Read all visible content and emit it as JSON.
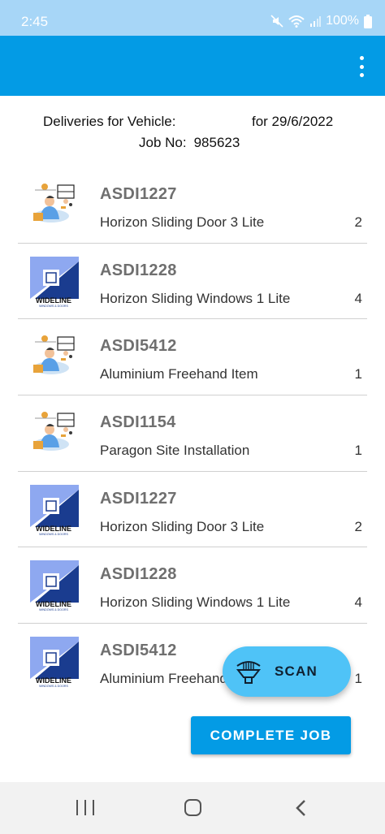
{
  "status_bar": {
    "time": "2:45",
    "battery": "100%"
  },
  "app_bar": {
    "menu_icon": "more-vert-icon"
  },
  "header": {
    "deliveries_label": "Deliveries for Vehicle:",
    "date_label": "for 29/6/2022",
    "job_label": "Job No:",
    "job_number": "985623"
  },
  "deliveries": [
    {
      "code": "ASDI1227",
      "description": "Horizon Sliding Door 3 Lite",
      "qty": "2",
      "thumb": "installer"
    },
    {
      "code": "ASDI1228",
      "description": "Horizon Sliding Windows 1 Lite",
      "qty": "4",
      "thumb": "wideline"
    },
    {
      "code": "ASDI5412",
      "description": "Aluminium Freehand Item",
      "qty": "1",
      "thumb": "installer"
    },
    {
      "code": "ASDI1154",
      "description": "Paragon Site Installation",
      "qty": "1",
      "thumb": "installer"
    },
    {
      "code": "ASDI1227",
      "description": "Horizon Sliding Door 3 Lite",
      "qty": "2",
      "thumb": "wideline"
    },
    {
      "code": "ASDI1228",
      "description": "Horizon Sliding Windows 1 Lite",
      "qty": "4",
      "thumb": "wideline"
    },
    {
      "code": "ASDI5412",
      "description": "Aluminium Freehand Item",
      "qty": "1",
      "thumb": "wideline"
    }
  ],
  "wideline_logo": {
    "name": "WIDELINE",
    "tagline": "WINDOWS & DOORS"
  },
  "scan_button": {
    "label": "SCAN",
    "icon": "barcode-scan-icon"
  },
  "complete_button": {
    "label": "COMPLETE JOB"
  },
  "nav_bar": {
    "recents_icon": "recents-icon",
    "home_icon": "home-icon",
    "back_icon": "back-icon"
  },
  "colors": {
    "app_bar": "#039be5",
    "status_bar": "#a7d6f7",
    "fab": "#4fc3f7",
    "logo_navy": "#1a3c8f",
    "logo_light": "#8ea8f0"
  }
}
